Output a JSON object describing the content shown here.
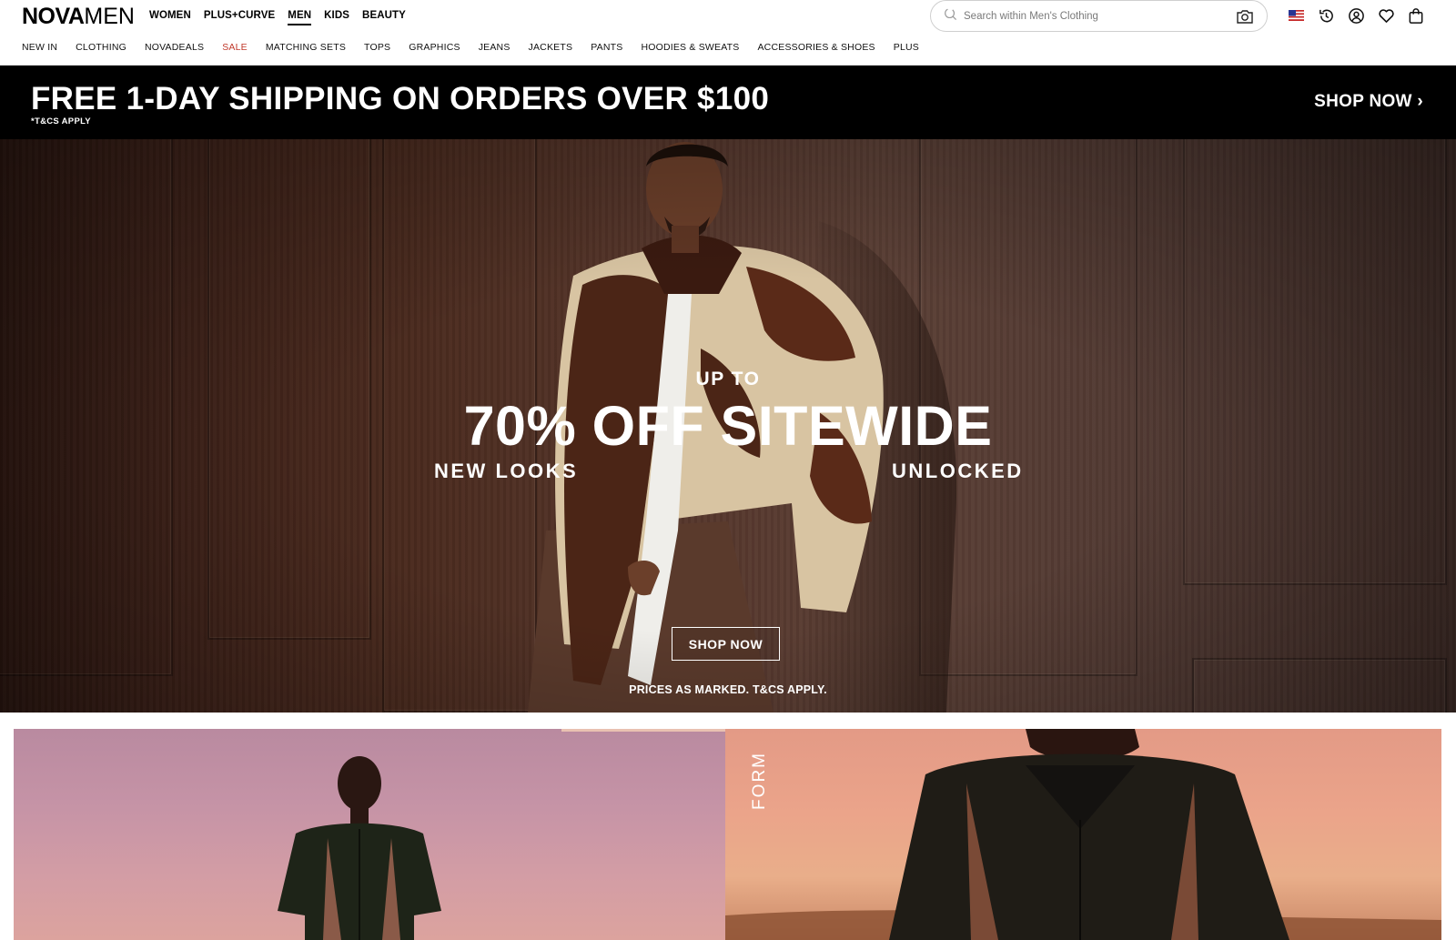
{
  "brand": {
    "logo_bold": "NOVA",
    "logo_thin": "MEN"
  },
  "topnav": [
    {
      "label": "WOMEN",
      "active": false
    },
    {
      "label": "PLUS+CURVE",
      "active": false
    },
    {
      "label": "MEN",
      "active": true
    },
    {
      "label": "KIDS",
      "active": false
    },
    {
      "label": "BEAUTY",
      "active": false
    }
  ],
  "search": {
    "placeholder": "Search within Men's Clothing",
    "value": ""
  },
  "header_icons": [
    "us-flag-icon",
    "history-icon",
    "account-icon",
    "heart-icon",
    "bag-icon"
  ],
  "subnav": [
    {
      "label": "NEW IN"
    },
    {
      "label": "CLOTHING"
    },
    {
      "label": "NOVADEALS"
    },
    {
      "label": "SALE"
    },
    {
      "label": "MATCHING SETS"
    },
    {
      "label": "TOPS"
    },
    {
      "label": "GRAPHICS"
    },
    {
      "label": "JEANS"
    },
    {
      "label": "JACKETS"
    },
    {
      "label": "PANTS"
    },
    {
      "label": "HOODIES & SWEATS"
    },
    {
      "label": "ACCESSORIES & SHOES"
    },
    {
      "label": "PLUS"
    }
  ],
  "promo": {
    "title": "FREE 1-DAY SHIPPING ON ORDERS OVER $100",
    "subtitle": "*T&CS APPLY",
    "cta": "SHOP NOW ›"
  },
  "hero": {
    "upto": "UP TO",
    "headline": "70% OFF SITEWIDE",
    "left_tag": "NEW LOOKS",
    "right_tag": "UNLOCKED",
    "button": "SHOP NOW",
    "terms": "PRICES AS MARKED. T&CS APPLY."
  },
  "tiles": {
    "right_label": "FORM"
  },
  "colors": {
    "sale": "#c0392b",
    "promo_bg": "#000000",
    "text": "#000000"
  }
}
